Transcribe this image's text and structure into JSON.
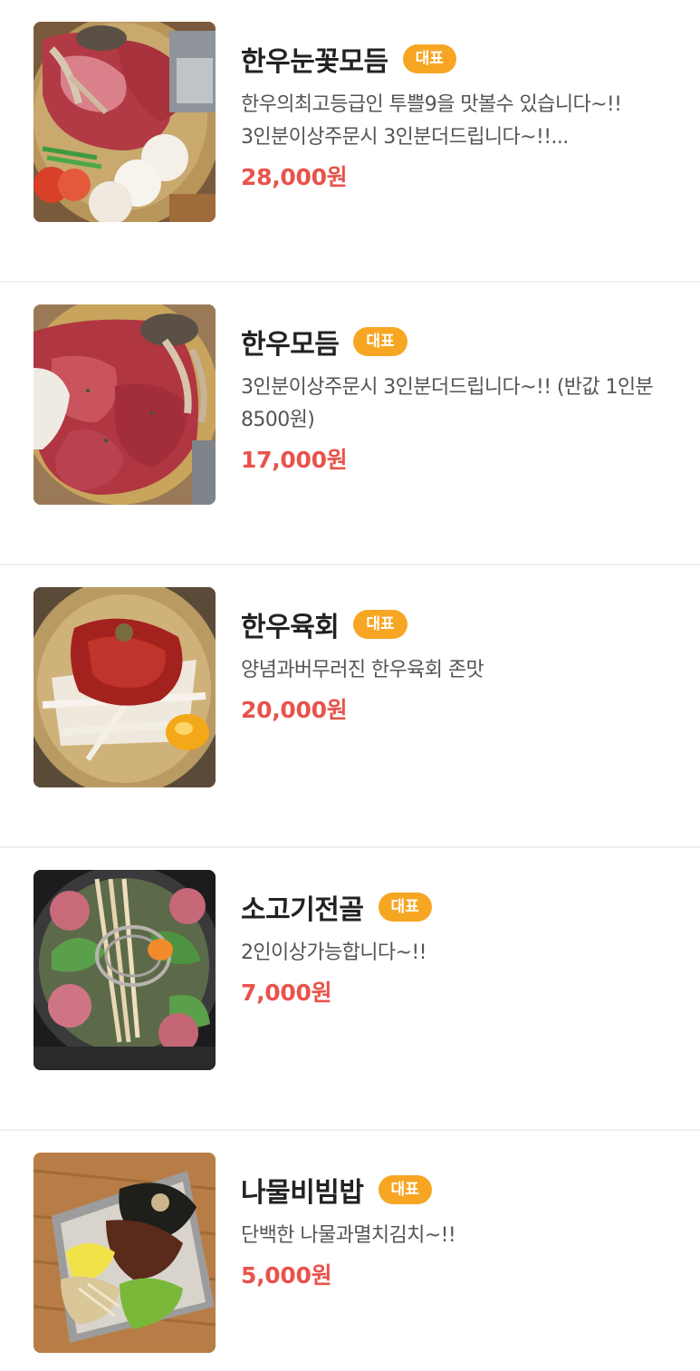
{
  "colors": {
    "badge": "#f7a623",
    "price": "#e8534b",
    "title": "#222222",
    "description": "#555555",
    "divider": "#f0f0f0"
  },
  "menu": [
    {
      "name": "한우눈꽃모듬",
      "badge": "대표",
      "description": "한우의최고등급인 투쁠9을 맛볼수 있습니다~!! 3인분이상주문시 3인분더드립니다~!!...",
      "price": "28,000원",
      "image_icon": "beef-platter-photo"
    },
    {
      "name": "한우모듬",
      "badge": "대표",
      "description": "3인분이상주문시 3인분더드립니다~!! (반값 1인분 8500원)",
      "price": "17,000원",
      "image_icon": "beef-platter-photo"
    },
    {
      "name": "한우육회",
      "badge": "대표",
      "description": "양념과버무러진 한우육회 존맛",
      "price": "20,000원",
      "image_icon": "yukhoe-photo"
    },
    {
      "name": "소고기전골",
      "badge": "대표",
      "description": "2인이상가능합니다~!!",
      "price": "7,000원",
      "image_icon": "hotpot-photo"
    },
    {
      "name": "나물비빔밥",
      "badge": "대표",
      "description": "단백한 나물과멸치김치~!!",
      "price": "5,000원",
      "image_icon": "bibimbap-photo"
    }
  ]
}
